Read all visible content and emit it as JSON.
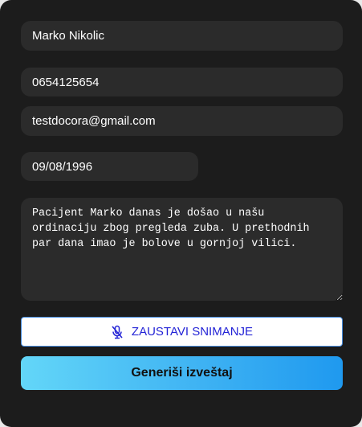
{
  "form": {
    "name_value": "Marko Nikolic",
    "phone_value": "0654125654",
    "email_value": "testdocora@gmail.com",
    "date_value": "09/08/1996",
    "notes_value": "Pacijent Marko danas je došao u našu ordinaciju zbog pregleda zuba. U prethodnih par dana imao je bolove u gornjoj vilici."
  },
  "buttons": {
    "stop_recording_label": "ZAUSTAVI SNIMANJE",
    "stop_recording_icon": "microphone-off-icon",
    "generate_label": "Generiši izveštaj"
  },
  "colors": {
    "panel_background": "#1c1c1c",
    "field_background": "#2b2b2b",
    "stop_button_text": "#2323d6",
    "stop_button_border": "#4a90e2",
    "generate_gradient_start": "#63d6f8",
    "generate_gradient_end": "#1f99ef"
  }
}
